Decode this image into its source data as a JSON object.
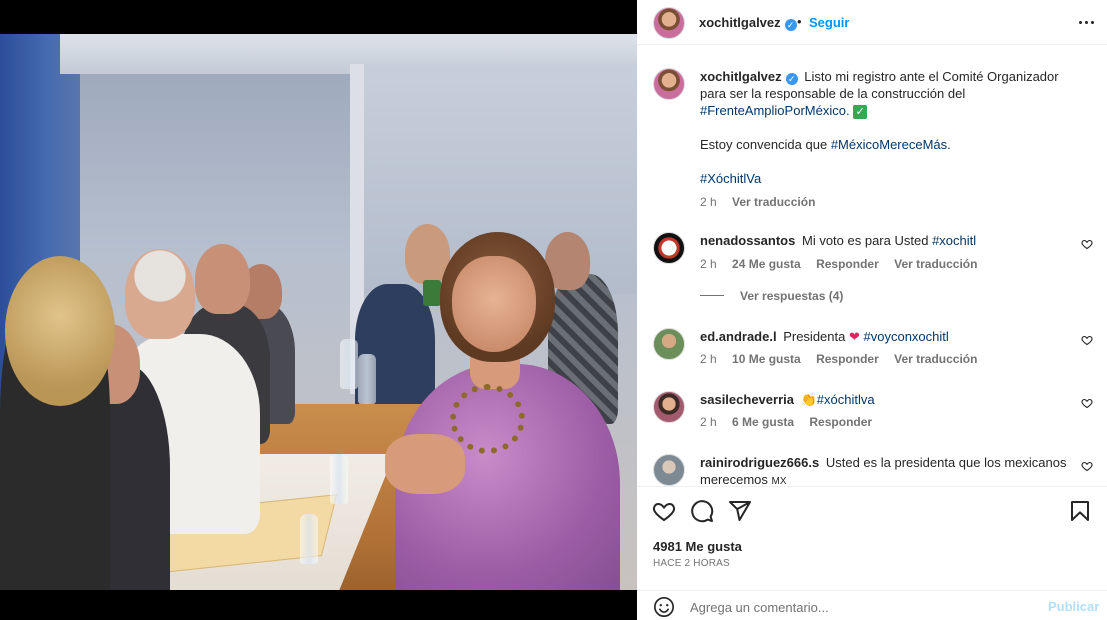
{
  "post": {
    "author": "xochitlgalvez",
    "follow_label": "Seguir",
    "separator": "•"
  },
  "caption": {
    "username": "xochitlgalvez",
    "text_1": "Listo mi registro ante el Comité Organizador para ser la responsable de la construcción del",
    "hashtag_1": "#FrenteAmplioPorMéxico.",
    "text_2": "Estoy convencida que",
    "hashtag_2": "#MéxicoMereceMás.",
    "hashtag_3": "#XóchitlVa",
    "time": "2 h",
    "translate": "Ver traducción"
  },
  "comments": [
    {
      "username": "nenadossantos",
      "text": "Mi voto es para Usted",
      "hashtag": "#xochitl",
      "time": "2 h",
      "likes": "24 Me gusta",
      "reply": "Responder",
      "translate": "Ver traducción",
      "replies_label": "Ver respuestas (4)"
    },
    {
      "username": "ed.andrade.l",
      "text": "Presidenta",
      "emoji": "❤",
      "hashtag": "#voyconxochitl",
      "time": "2 h",
      "likes": "10 Me gusta",
      "reply": "Responder",
      "translate": "Ver traducción"
    },
    {
      "username": "sasilecheverria",
      "emoji": "👏",
      "hashtag": "#xóchitlva",
      "time": "2 h",
      "likes": "6 Me gusta",
      "reply": "Responder"
    },
    {
      "username": "rainirodriguez666.s",
      "text": "Usted es la presidenta que los mexicanos merecemos",
      "suffix": "MX"
    }
  ],
  "actions": {
    "icons": [
      "heart-icon",
      "comment-icon",
      "share-icon",
      "bookmark-icon"
    ],
    "likes": "4981 Me gusta",
    "time": "HACE 2 HORAS"
  },
  "add_comment": {
    "placeholder": "Agrega un comentario...",
    "publish_label": "Publicar"
  },
  "colors": {
    "accent": "#0095f6",
    "hashtag": "#00376b",
    "muted": "#737373",
    "publish_disabled": "#b2dffc"
  }
}
